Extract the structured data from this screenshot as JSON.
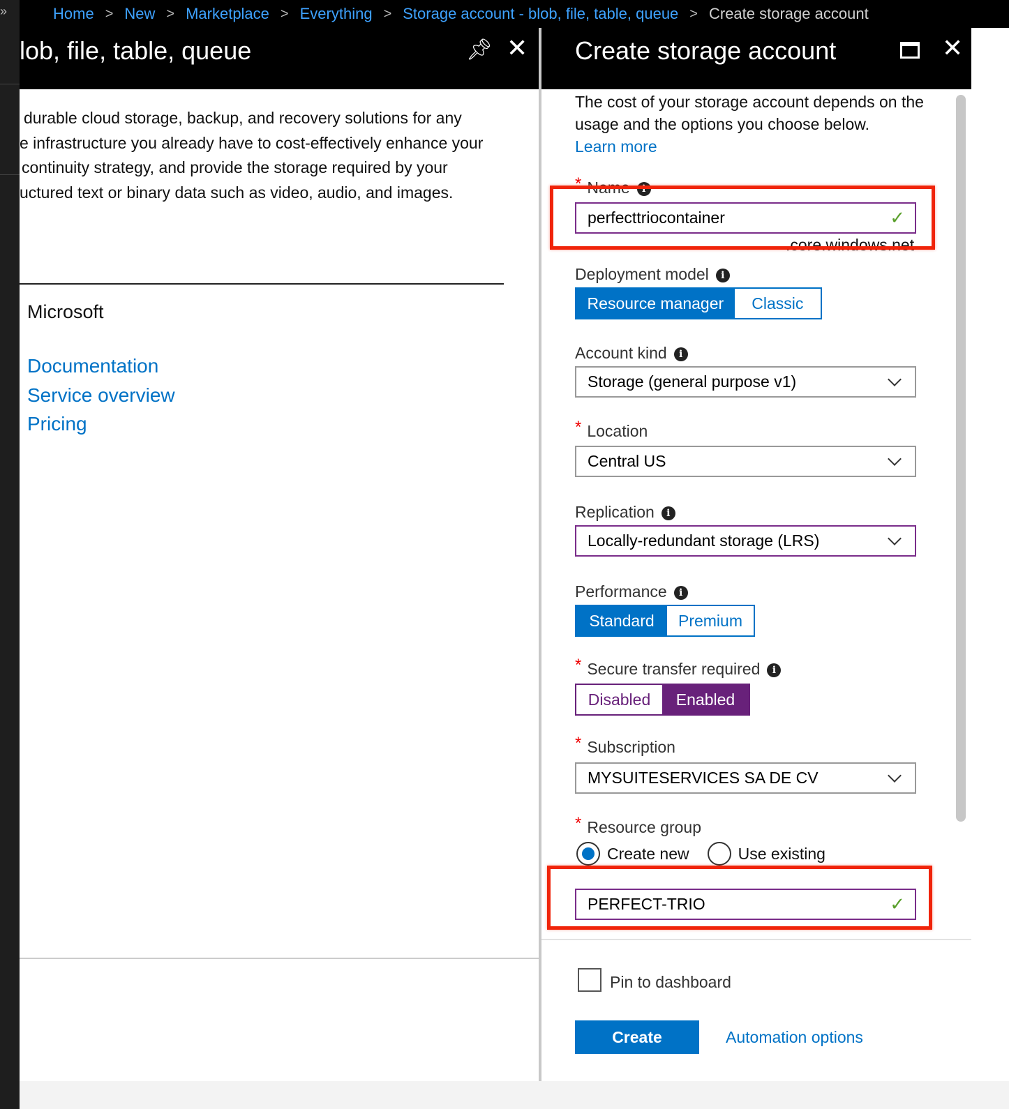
{
  "breadcrumb": {
    "items": [
      "Home",
      "New",
      "Marketplace",
      "Everything",
      "Storage account - blob, file, table, queue"
    ],
    "current": "Create storage account",
    "separator": ">"
  },
  "left_blade": {
    "title": "lob, file, table, queue",
    "description_lines": [
      "durable cloud storage, backup, and recovery solutions for any",
      "e infrastructure you already have to cost-effectively enhance your",
      "continuity strategy, and provide the storage required by your",
      "uctured text or binary data such as video, audio, and images."
    ],
    "publisher": "Microsoft",
    "links": [
      "Documentation",
      "Service overview",
      "Pricing"
    ]
  },
  "right_blade": {
    "title": "Create storage account",
    "intro": "The cost of your storage account depends on the usage and the options you choose below.",
    "learn_more": "Learn more",
    "name": {
      "label": "Name",
      "value": "perfecttriocontainer",
      "suffix": ".core.windows.net"
    },
    "deployment_model": {
      "label": "Deployment model",
      "options": [
        "Resource manager",
        "Classic"
      ],
      "selected": "Resource manager"
    },
    "account_kind": {
      "label": "Account kind",
      "value": "Storage (general purpose v1)"
    },
    "location": {
      "label": "Location",
      "value": "Central US"
    },
    "replication": {
      "label": "Replication",
      "value": "Locally-redundant storage (LRS)"
    },
    "performance": {
      "label": "Performance",
      "options": [
        "Standard",
        "Premium"
      ],
      "selected": "Standard"
    },
    "secure_transfer": {
      "label": "Secure transfer required",
      "options": [
        "Disabled",
        "Enabled"
      ],
      "selected": "Enabled"
    },
    "subscription": {
      "label": "Subscription",
      "value": "MYSUITESERVICES SA DE CV"
    },
    "resource_group": {
      "label": "Resource group",
      "options": [
        "Create new",
        "Use existing"
      ],
      "selected": "Create new",
      "value": "PERFECT-TRIO"
    },
    "pin_to_dashboard": "Pin to dashboard",
    "create_button": "Create",
    "automation_options": "Automation options"
  },
  "colors": {
    "accent": "#0072c6",
    "secure_transfer": "#68217a",
    "highlight": "#f0240a",
    "valid_check": "#5aa02c"
  }
}
